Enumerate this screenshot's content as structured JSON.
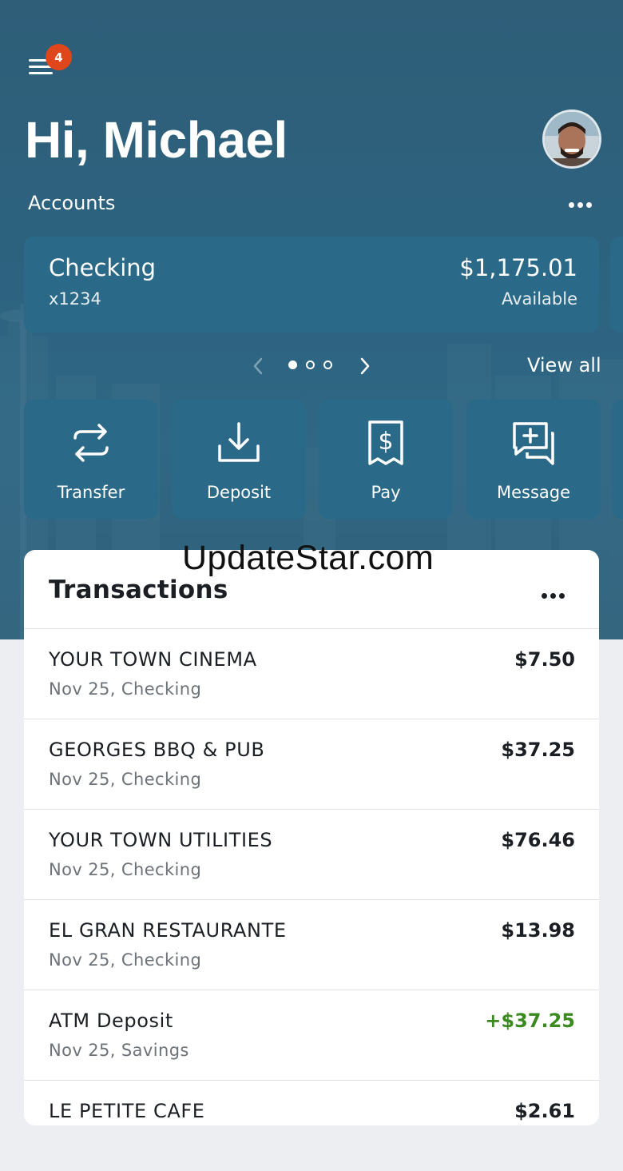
{
  "header": {
    "notification_count": "4",
    "greeting": "Hi, Michael",
    "accounts_label": "Accounts"
  },
  "account": {
    "name": "Checking",
    "number": "x1234",
    "balance": "$1,175.01",
    "balance_label": "Available"
  },
  "carousel": {
    "page_count": 3,
    "active_page": 1,
    "view_all_label": "View all"
  },
  "actions": [
    {
      "label": "Transfer",
      "icon": "transfer-icon"
    },
    {
      "label": "Deposit",
      "icon": "deposit-icon"
    },
    {
      "label": "Pay",
      "icon": "pay-bill-icon"
    },
    {
      "label": "Message",
      "icon": "message-icon"
    }
  ],
  "transactions": {
    "title": "Transactions",
    "items": [
      {
        "merchant": "YOUR TOWN CINEMA",
        "detail": "Nov 25, Checking",
        "amount": "$7.50",
        "credit": false
      },
      {
        "merchant": "GEORGES BBQ & PUB",
        "detail": "Nov 25, Checking",
        "amount": "$37.25",
        "credit": false
      },
      {
        "merchant": "YOUR TOWN UTILITIES",
        "detail": "Nov 25, Checking",
        "amount": "$76.46",
        "credit": false
      },
      {
        "merchant": "EL GRAN RESTAURANTE",
        "detail": "Nov 25, Checking",
        "amount": "$13.98",
        "credit": false
      },
      {
        "merchant": "ATM Deposit",
        "detail": "Nov 25, Savings",
        "amount": "+$37.25",
        "credit": true
      },
      {
        "merchant": "LE PETITE CAFE",
        "detail": "",
        "amount": "$2.61",
        "credit": false
      }
    ]
  },
  "watermark": "UpdateStar.com",
  "colors": {
    "hero_bg": "#2e6280",
    "card_bg": "#2a6987",
    "badge": "#e0461c",
    "credit": "#3b8a1f"
  }
}
